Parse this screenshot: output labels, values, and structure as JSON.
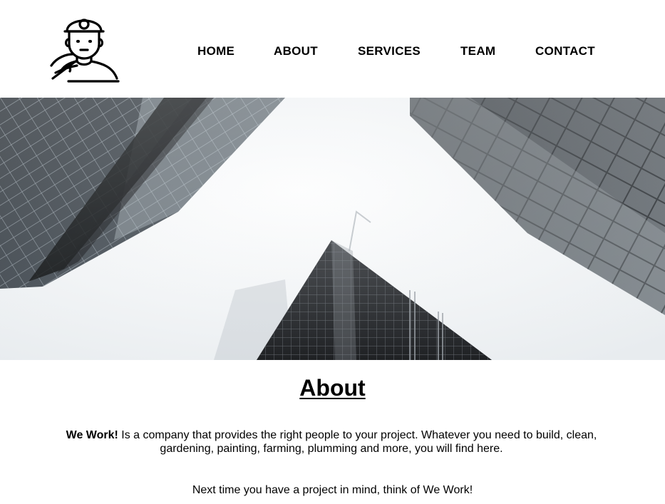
{
  "header": {
    "logo_icon": "miner-worker-icon",
    "nav": [
      {
        "label": "HOME"
      },
      {
        "label": "ABOUT"
      },
      {
        "label": "SERVICES"
      },
      {
        "label": "TEAM"
      },
      {
        "label": "CONTACT"
      }
    ]
  },
  "hero": {
    "image": "skyscrapers-looking-up-photo"
  },
  "about": {
    "title": "About",
    "brand": "We Work!",
    "description": " Is a company that provides the right people to your project. Whatever you need to build, clean, gardening, painting, farming, plumming and more, you will find here.",
    "closing": "Next time you have a project in mind, think of We Work!"
  },
  "colors": {
    "text": "#000000",
    "background": "#ffffff",
    "sky": "#f4f6f8"
  }
}
